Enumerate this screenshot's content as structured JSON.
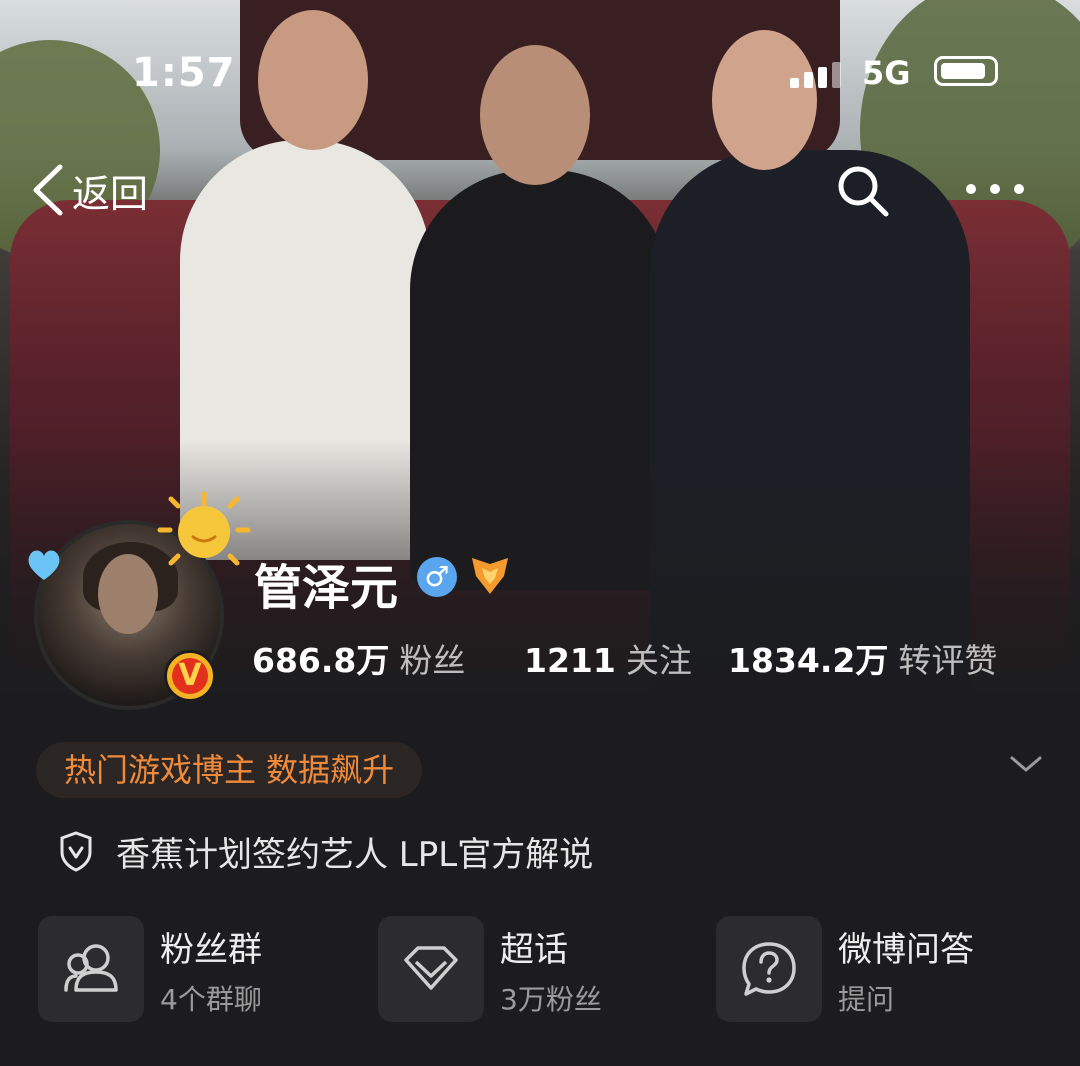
{
  "status_bar": {
    "time": "1:57",
    "network": "5G"
  },
  "nav": {
    "back_label": "返回"
  },
  "profile": {
    "name": "管泽元",
    "gender_symbol": "♂",
    "verified_badge": "V"
  },
  "stats": [
    {
      "value": "686.8万",
      "label": "粉丝"
    },
    {
      "value": "1211",
      "label": "关注"
    },
    {
      "value": "1834.2万",
      "label": "转评赞"
    }
  ],
  "tag": "热门游戏博主 数据飙升",
  "certification": "香蕉计划签约艺人 LPL官方解说",
  "features": [
    {
      "title": "粉丝群",
      "subtitle": "4个群聊",
      "icon": "group-icon"
    },
    {
      "title": "超话",
      "subtitle": "3万粉丝",
      "icon": "diamond-icon"
    },
    {
      "title": "微博问答",
      "subtitle": "提问",
      "icon": "question-icon"
    }
  ],
  "colors": {
    "tag_orange": "#f08a3b",
    "background": "#1c1c1e",
    "gender_blue": "#59a6ee",
    "verified_yellow": "#f5b324"
  }
}
